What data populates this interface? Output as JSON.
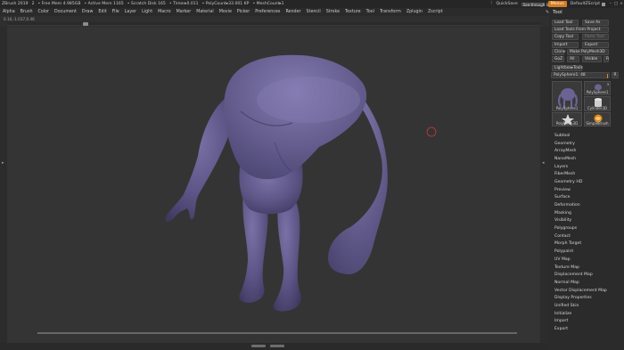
{
  "titlebar": {
    "app": "ZBrush 2019",
    "doc_num": "2",
    "free_mem": "• Free Mem 4.985GB",
    "active_mem": "• Active Mem 1165",
    "scratch_disk": "• Scratch Disk 165",
    "timer": "• Timer▸0.011",
    "poly_count": "• PolyCount▸33.001 KP",
    "mesh_count": "• MeshCount▸1",
    "quicksave": "QuickSave",
    "see_through": "See-through 0",
    "menus": "Menus",
    "default_script": "DefaultZScript"
  },
  "menubar": {
    "items": [
      "Alpha",
      "Brush",
      "Color",
      "Document",
      "Draw",
      "Edit",
      "File",
      "Layer",
      "Light",
      "Macro",
      "Marker",
      "Material",
      "Movie",
      "Picker",
      "Preferences",
      "Render",
      "Stencil",
      "Stroke",
      "Texture",
      "Tool",
      "Transform",
      "Zplugin",
      "Zscript"
    ]
  },
  "coords": "0.16,-1.037,0.46",
  "panel": {
    "title": "Tool",
    "load_tool": "Load Tool",
    "save_as": "Save As",
    "load_tools_from_project": "Load Tools From Project",
    "copy_tool": "Copy Tool",
    "paste_tool": "Paste Tool",
    "import": "Import",
    "export": "Export",
    "clone": "Clone",
    "make_polymesh3d": "Make PolyMesh3D",
    "goz": "GoZ",
    "all": "All",
    "visible": "Visible",
    "r": "R",
    "lightbox_tools": "Lightbox▸Tools",
    "slider_label": "PolySphere1: 48",
    "slider_r": "R",
    "thumbs": [
      {
        "label": "PolySphere1",
        "num": ""
      },
      {
        "label": "PolySphere1",
        "num": "3"
      },
      {
        "label": "Cylinder3D",
        "num": ""
      },
      {
        "label": "PolyMesh3D",
        "num": ""
      },
      {
        "label": "SimpleBrush",
        "num": ""
      }
    ],
    "subpalettes": [
      "Subtool",
      "Geometry",
      "ArrayMesh",
      "NanoMesh",
      "Layers",
      "FiberMesh",
      "Geometry HD",
      "Preview",
      "Surface",
      "Deformation",
      "Masking",
      "Visibility",
      "Polygroups",
      "Contact",
      "Morph Target",
      "Polypaint",
      "UV Map",
      "Texture Map",
      "Displacement Map",
      "Normal Map",
      "Vector Displacement Map",
      "Display Properties",
      "Unified Skin",
      "Initialize",
      "Import",
      "Export"
    ]
  },
  "colors": {
    "accent_orange": "#d97c1a",
    "mesh_base": "#6b6393",
    "brush_cursor": "#c83a3a"
  }
}
